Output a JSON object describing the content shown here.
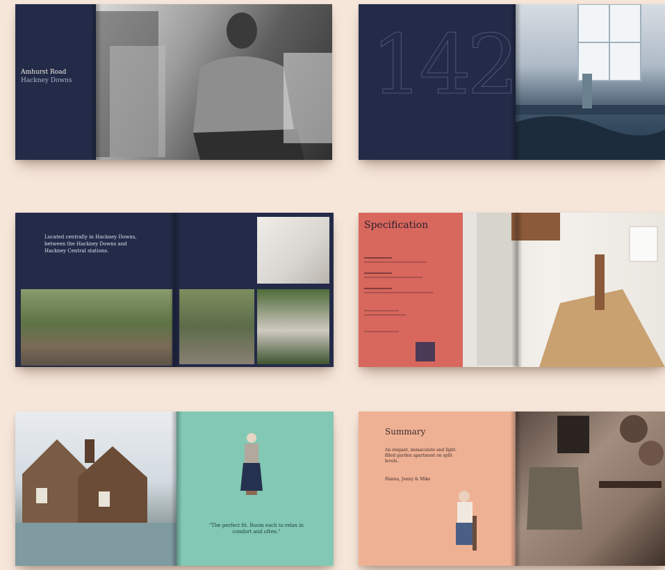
{
  "books": [
    {
      "title": "Amhurst Road",
      "subtitle": "Hackney Downs"
    },
    {
      "number": "142"
    },
    {
      "intro": "Located centrally in Hackney Downs, between the Hackney Downs and Hackney Central stations."
    },
    {
      "title": "Specification"
    },
    {
      "quote": "\"The perfect fit. Room each to relax in comfort and often.\""
    },
    {
      "title": "Summary",
      "body": "An elegant, immaculate and light-filled garden apartment on split levels.",
      "subtitle": "Hanna, Jenny & Mike"
    }
  ]
}
